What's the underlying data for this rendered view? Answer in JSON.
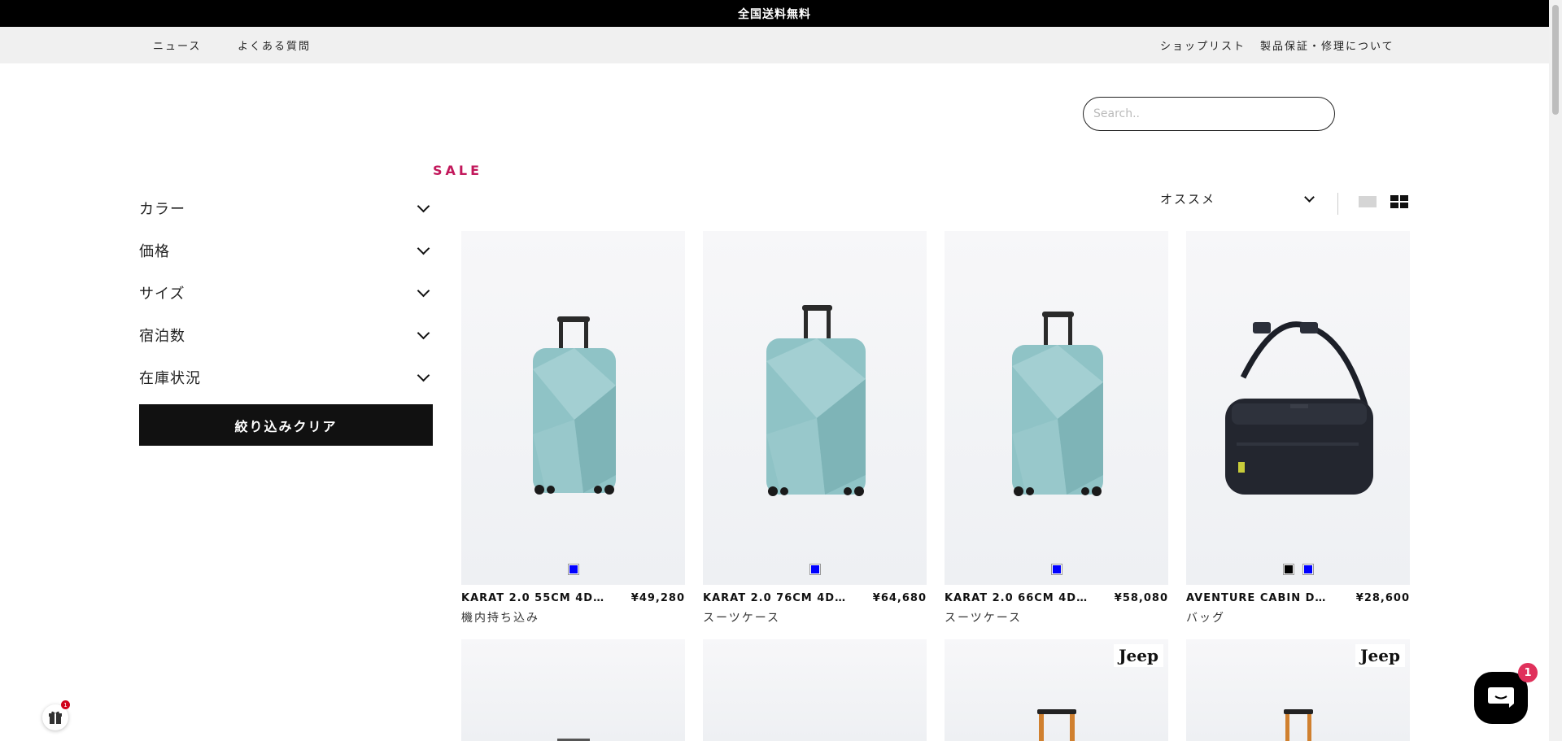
{
  "announcement": "全国送料無料",
  "utility_nav": {
    "left": [
      "ニュース",
      "よくある質問"
    ],
    "right": [
      "ショップリスト",
      "製品保証・修理について"
    ]
  },
  "search": {
    "placeholder": "Search.."
  },
  "collection": {
    "title": "SALE"
  },
  "filters": [
    "カラー",
    "価格",
    "サイズ",
    "宿泊数",
    "在庫状況"
  ],
  "clear_filters_label": "絞り込みクリア",
  "sort": {
    "selected": "オススメ"
  },
  "products": [
    {
      "name": "KARAT 2.0 55CM 4D…",
      "price": "¥49,280",
      "category": "機内持ち込み",
      "swatches": [
        "#0000ff"
      ]
    },
    {
      "name": "KARAT 2.0 76CM 4D…",
      "price": "¥64,680",
      "category": "スーツケース",
      "swatches": [
        "#0000ff"
      ]
    },
    {
      "name": "KARAT 2.0 66CM 4D…",
      "price": "¥58,080",
      "category": "スーツケース",
      "swatches": [
        "#0000ff"
      ]
    },
    {
      "name": "AVENTURE CABIN D…",
      "price": "¥28,600",
      "category": "バッグ",
      "swatches": [
        "#000000",
        "#0000ff"
      ]
    }
  ],
  "second_row_brand_badge": "Jeep",
  "gift_widget": {
    "badge": "1"
  },
  "chat_widget": {
    "badge": "1"
  },
  "colors": {
    "sale_accent": "#c2185b",
    "suitcase_teal": "#8fc3c6",
    "chat_badge": "#e0315b"
  }
}
